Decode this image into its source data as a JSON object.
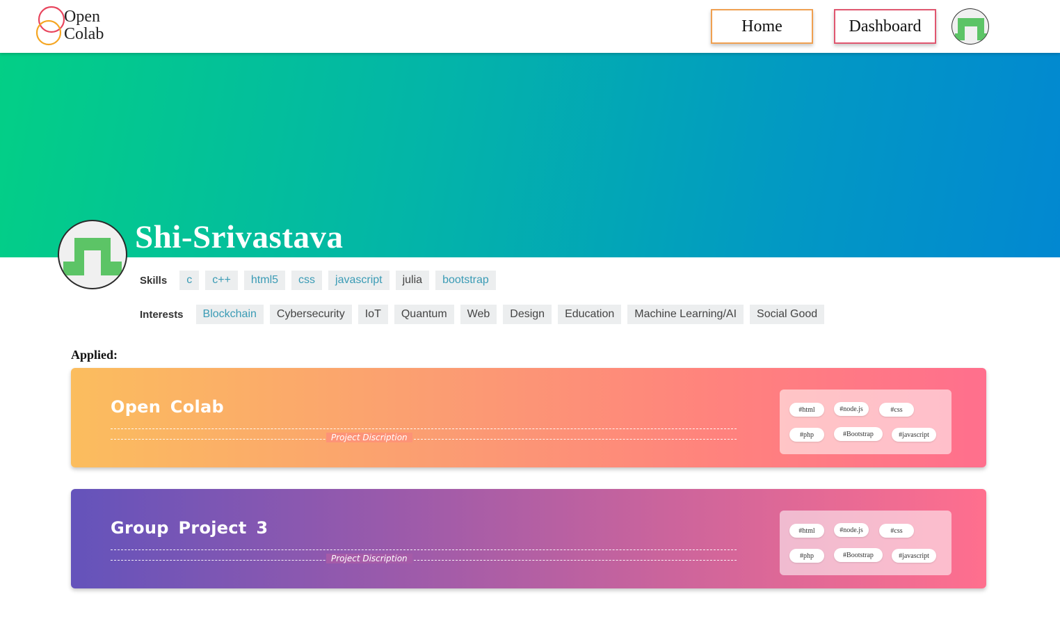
{
  "header": {
    "logo_line1": "Open",
    "logo_line2": "Colab",
    "nav": {
      "home": "Home",
      "dashboard": "Dashboard"
    }
  },
  "profile": {
    "username": "Shi-Srivastava",
    "skills_label": "Skills",
    "skills": [
      "c",
      "c++",
      "html5",
      "css",
      "javascript",
      "julia",
      "bootstrap"
    ],
    "interests_label": "Interests",
    "interests": [
      "Blockchain",
      "Cybersecurity",
      "IoT",
      "Quantum",
      "Web",
      "Design",
      "Education",
      "Machine Learning/AI",
      "Social Good"
    ]
  },
  "applied": {
    "label": "Applied:",
    "projects": [
      {
        "title": "Open Colab",
        "description": "Project Discription",
        "tags": [
          "#html",
          "#node.js",
          "#css",
          "#php",
          "#Bootstrap",
          "#javascript"
        ]
      },
      {
        "title": "Group Project 3",
        "description": "Project Discription",
        "tags": [
          "#html",
          "#node.js",
          "#css",
          "#php",
          "#Bootstrap",
          "#javascript"
        ]
      }
    ]
  },
  "colors": {
    "logo_ring_top": "#e8455d",
    "logo_ring_bottom": "#f5a623",
    "avatar_green": "#5cc466",
    "banner_start": "#03cf86",
    "banner_end": "#0288d1",
    "active_tag_text": "#3a9bb5"
  },
  "icons": {
    "logo": "open-colab-rings-logo",
    "avatar": "identicon-avatar"
  }
}
